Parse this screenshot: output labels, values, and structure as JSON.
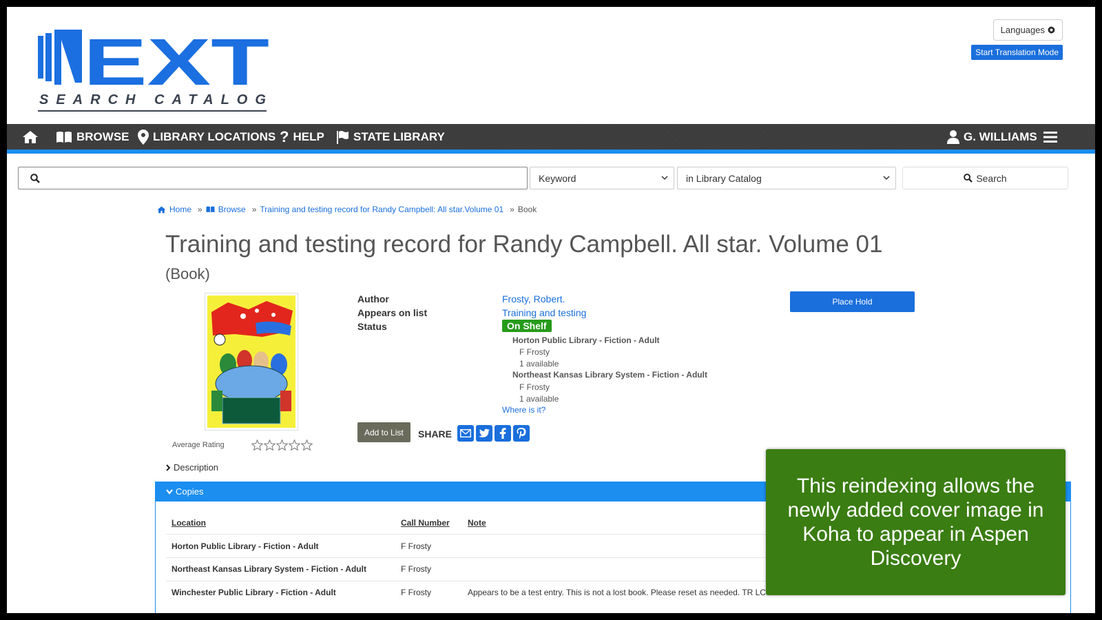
{
  "logo": {
    "word": "NEXT",
    "sub": "SEARCH CATALOG"
  },
  "header": {
    "languages_label": "Languages",
    "translation_label": "Start Translation Mode"
  },
  "nav": {
    "browse": "BROWSE",
    "locations": "LIBRARY LOCATIONS",
    "help": "HELP",
    "state_library": "STATE LIBRARY",
    "user": "G. WILLIAMS"
  },
  "search": {
    "query": "",
    "type_selected": "Keyword",
    "scope_selected": "in Library Catalog",
    "button_label": "Search"
  },
  "breadcrumb": {
    "home": "Home",
    "browse": "Browse",
    "list": "Training and testing record for Randy Campbell: All star.Volume 01",
    "current": "Book"
  },
  "record": {
    "title": "Training and testing record for Randy Campbell. All star. Volume 01",
    "format": "(Book)",
    "author_label": "Author",
    "author": "Frosty, Robert.",
    "list_label": "Appears on list",
    "list_value": "Training and testing",
    "status_label": "Status",
    "status": "On Shelf",
    "holdings": [
      {
        "library": "Horton Public Library - Fiction - Adult",
        "call": "F Frosty",
        "avail": "1 available"
      },
      {
        "library": "Northeast Kansas Library System - Fiction - Adult",
        "call": "F Frosty",
        "avail": "1 available"
      }
    ],
    "where_link": "Where is it?",
    "place_hold": "Place Hold",
    "add_to_list": "Add to List",
    "share_label": "SHARE",
    "avg_rating_label": "Average Rating",
    "rating": 0,
    "description_label": "Description"
  },
  "copies": {
    "header": "Copies",
    "columns": [
      "Location",
      "Call Number",
      "Note"
    ],
    "rows": [
      {
        "location": "Horton Public Library - Fiction - Adult",
        "call": "F Frosty",
        "note": ""
      },
      {
        "location": "Northeast Kansas Library System - Fiction - Adult",
        "call": "F Frosty",
        "note": ""
      },
      {
        "location": "Winchester Public Library - Fiction - Adult",
        "call": "F Frosty",
        "note": "Appears to be a test entry. This is not a lost book. Please reset as needed. TR LC"
      }
    ]
  },
  "callout": "This reindexing allows the newly added cover image in Koha to appear in Aspen Discovery",
  "colors": {
    "nav": "#3b3b3b",
    "accent": "#1b8ef0",
    "link": "#1a6fdc",
    "status": "#279b1b",
    "callout": "#3a7d12"
  }
}
